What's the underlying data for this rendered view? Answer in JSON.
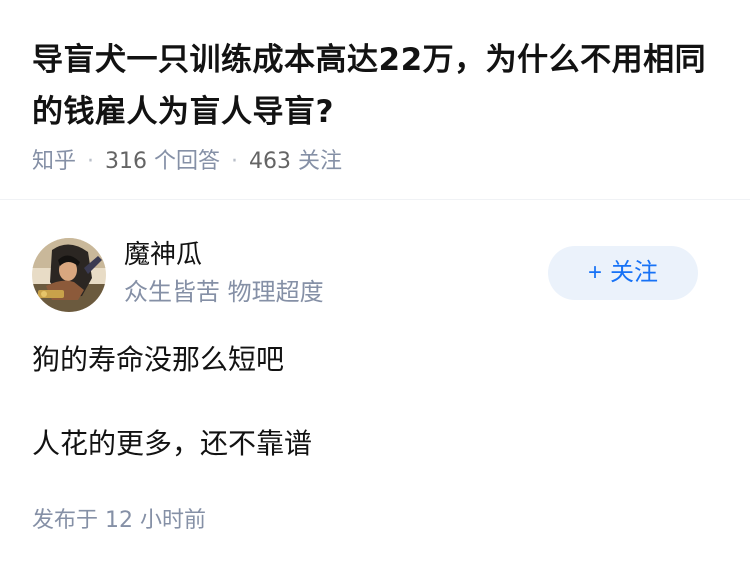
{
  "question": {
    "title": "导盲犬一只训练成本高达22万，为什么不用相同的钱雇人为盲人导盲?",
    "source": "知乎",
    "separator": "·",
    "answer_count": "316",
    "answer_label": "个回答",
    "follower_count": "463",
    "follower_label": "关注"
  },
  "author": {
    "name": "魔神瓜",
    "headline": "众生皆苦 物理超度",
    "avatar_icon": "avatar-image"
  },
  "follow_button": {
    "icon": "plus-icon",
    "plus": "+",
    "label": "关注",
    "background": "#ebf2fb",
    "color": "#1772f6"
  },
  "answer": {
    "paragraphs": [
      "狗的寿命没那么短吧",
      "人花的更多，还不靠谱"
    ],
    "time_prefix": "发布于",
    "time_value": "12 小时前"
  },
  "colors": {
    "text_primary": "#121212",
    "text_secondary": "#8590a6",
    "divider": "#f0f2f5"
  }
}
